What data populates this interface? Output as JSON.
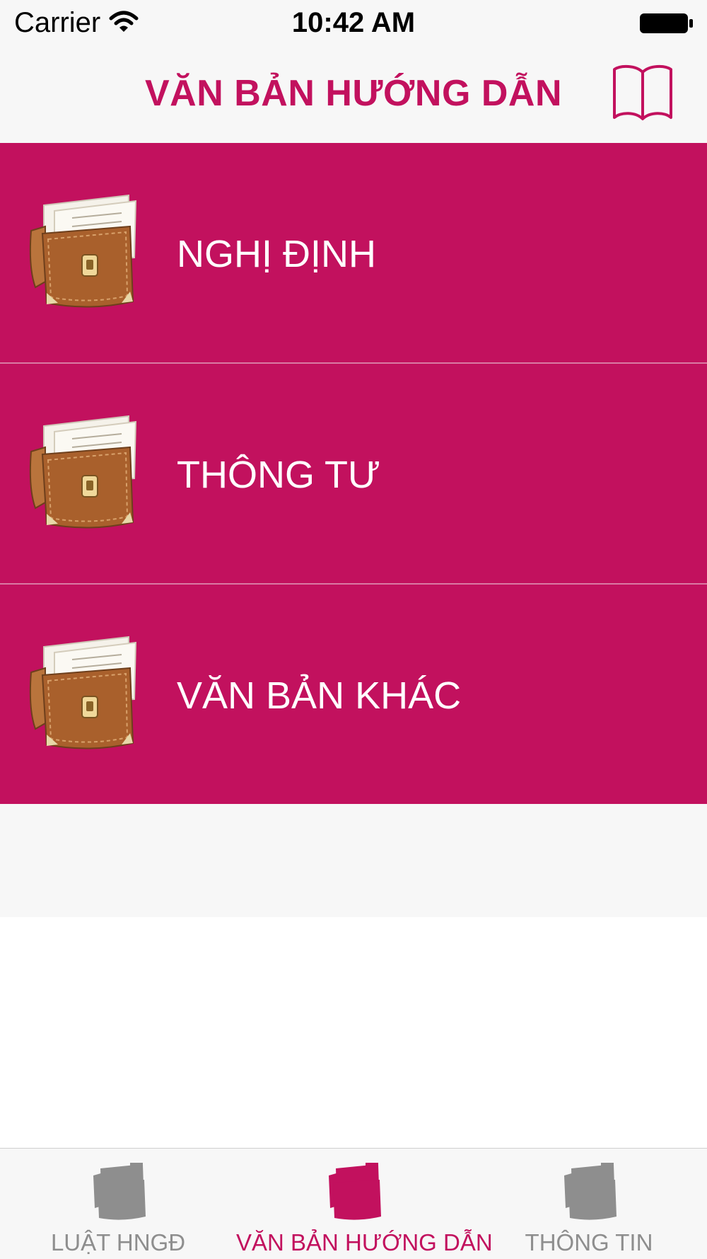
{
  "status_bar": {
    "carrier": "Carrier",
    "time": "10:42 AM"
  },
  "nav": {
    "title": "VĂN BẢN HƯỚNG DẪN",
    "action_icon": "book-open-icon"
  },
  "list": {
    "items": [
      {
        "label": "NGHỊ ĐỊNH",
        "icon": "briefcase-documents-icon"
      },
      {
        "label": "THÔNG TƯ",
        "icon": "briefcase-documents-icon"
      },
      {
        "label": "VĂN BẢN KHÁC",
        "icon": "briefcase-documents-icon"
      }
    ]
  },
  "tab_bar": {
    "tabs": [
      {
        "label": "LUẬT HNGĐ",
        "icon": "document-stack-icon",
        "selected": false
      },
      {
        "label": "VĂN BẢN HƯỚNG DẪN",
        "icon": "document-stack-icon",
        "selected": true
      },
      {
        "label": "THÔNG TIN",
        "icon": "document-stack-icon",
        "selected": false
      }
    ]
  },
  "colors": {
    "accent": "#c2115e",
    "tab_inactive": "#8e8e8e",
    "bar_background": "#f7f7f7"
  }
}
